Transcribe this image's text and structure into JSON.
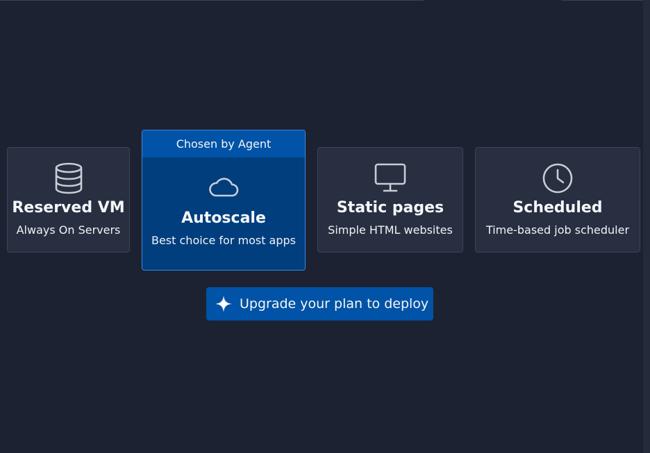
{
  "deployment_options": {
    "reserved_vm": {
      "title": "Reserved VM",
      "subtitle": "Always On Servers",
      "icon": "database-icon"
    },
    "autoscale": {
      "badge": "Chosen by Agent",
      "title": "Autoscale",
      "subtitle": "Best choice for most apps",
      "icon": "cloud-icon",
      "selected": true
    },
    "static_pages": {
      "title": "Static pages",
      "subtitle": "Simple HTML websites",
      "icon": "monitor-icon"
    },
    "scheduled": {
      "title": "Scheduled",
      "subtitle": "Time-based job scheduler",
      "icon": "clock-icon"
    }
  },
  "upgrade_button": {
    "label": "Upgrade your plan to deploy",
    "icon": "sparkle-icon"
  },
  "colors": {
    "background": "#1c2232",
    "card": "#272f40",
    "selected_card": "#003e7e",
    "accent": "#0053a6",
    "selected_border": "#3a87e0",
    "icon": "#c8cdd6"
  }
}
